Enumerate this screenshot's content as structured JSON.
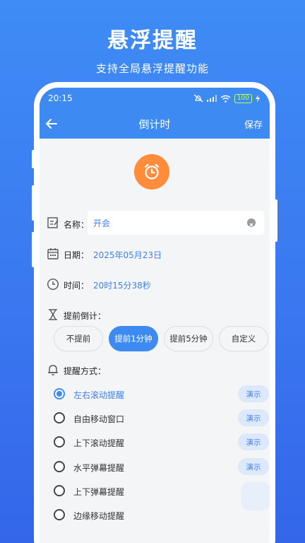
{
  "promo": {
    "title": "悬浮提醒",
    "subtitle": "支持全局悬浮提醒功能"
  },
  "status_bar": {
    "time": "20:15",
    "battery": "100"
  },
  "app_bar": {
    "title": "倒计时",
    "save_label": "保存"
  },
  "form": {
    "name_label": "名称：",
    "name_value": "开会",
    "date_label": "日期：",
    "date_value": "2025年05月23日",
    "time_label": "时间：",
    "time_value": "20时15分38秒",
    "advance_label": "提前倒计：",
    "method_label": "提醒方式："
  },
  "advance_options": [
    {
      "label": "不提前",
      "selected": false
    },
    {
      "label": "提前1分钟",
      "selected": true
    },
    {
      "label": "提前5分钟",
      "selected": false
    },
    {
      "label": "自定义",
      "selected": false
    }
  ],
  "reminder_methods": [
    {
      "label": "左右滚动提醒",
      "selected": true,
      "demo": "演示"
    },
    {
      "label": "自由移动窗口",
      "selected": false,
      "demo": "演示"
    },
    {
      "label": "上下滚动提醒",
      "selected": false,
      "demo": "演示"
    },
    {
      "label": "水平弹幕提醒",
      "selected": false,
      "demo": "演示"
    },
    {
      "label": "上下弹幕提醒",
      "selected": false,
      "demo": ""
    },
    {
      "label": "边缘移动提醒",
      "selected": false,
      "demo": ""
    }
  ],
  "colors": {
    "primary": "#3d8af3",
    "accent": "#ff8c3b",
    "link": "#3d7ff0"
  }
}
